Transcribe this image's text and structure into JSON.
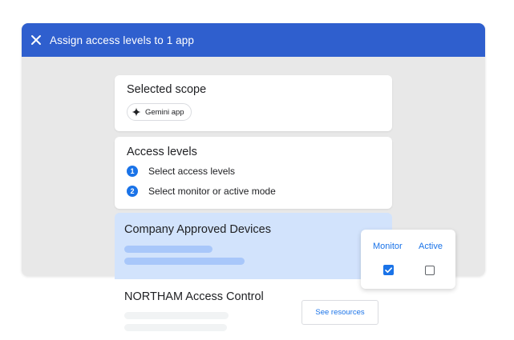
{
  "header": {
    "title": "Assign access levels to 1 app"
  },
  "scope": {
    "title": "Selected scope",
    "chip_label": "Gemini app",
    "chip_icon": "sparkle-icon"
  },
  "access_levels": {
    "title": "Access levels",
    "steps": [
      {
        "number": "1",
        "label": "Select access levels"
      },
      {
        "number": "2",
        "label": "Select monitor or active mode"
      }
    ]
  },
  "levels": [
    {
      "name": "Company Approved Devices",
      "selected": true
    },
    {
      "name": "NORTHAM Access Control",
      "button_label": "See resources"
    }
  ],
  "mode": {
    "monitor_label": "Monitor",
    "monitor_checked": true,
    "active_label": "Active",
    "active_checked": false
  },
  "colors": {
    "header": "#2f5fce",
    "accent": "#1a73e8",
    "selected_row": "#d2e3fc"
  }
}
